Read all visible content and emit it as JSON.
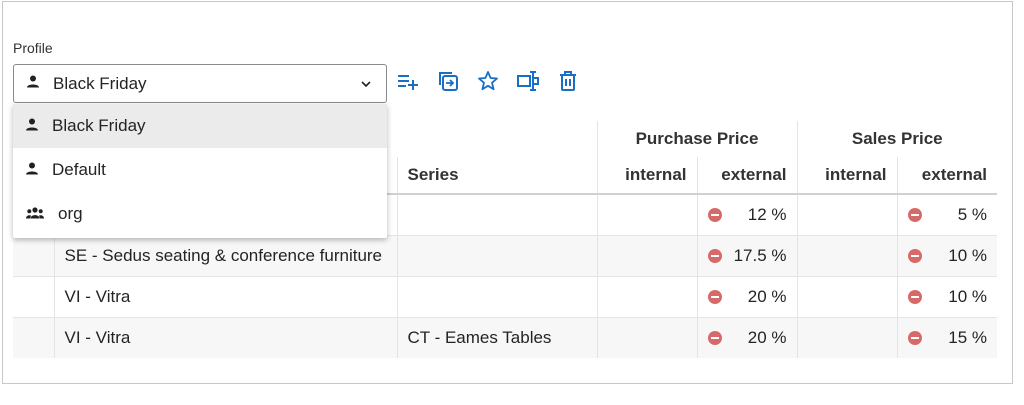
{
  "profile": {
    "label": "Profile",
    "selected": "Black Friday",
    "options": [
      {
        "label": "Black Friday",
        "icon": "person-icon"
      },
      {
        "label": "Default",
        "icon": "person-icon"
      },
      {
        "label": "org",
        "icon": "group-icon"
      }
    ]
  },
  "toolbar": {
    "icons": [
      "add-list-icon",
      "copy-icon",
      "star-icon",
      "rename-icon",
      "delete-icon"
    ],
    "accent": "#1a6fc4"
  },
  "table": {
    "group_headers": {
      "purchase": "Purchase Price",
      "sales": "Sales Price"
    },
    "columns": {
      "series": "Series",
      "internal": "internal",
      "external": "external"
    },
    "rows": [
      {
        "supplier": "",
        "series": "",
        "purchase_external": "12 %",
        "sales_external": "5 %"
      },
      {
        "supplier": "SE - Sedus seating & conference furniture",
        "series": "",
        "purchase_external": "17.5 %",
        "sales_external": "10 %"
      },
      {
        "supplier": "VI - Vitra",
        "series": "",
        "purchase_external": "20 %",
        "sales_external": "10 %"
      },
      {
        "supplier": "VI - Vitra",
        "series": "CT - Eames Tables",
        "purchase_external": "20 %",
        "sales_external": "15 %"
      }
    ],
    "discount_color": "#d66a6a"
  }
}
